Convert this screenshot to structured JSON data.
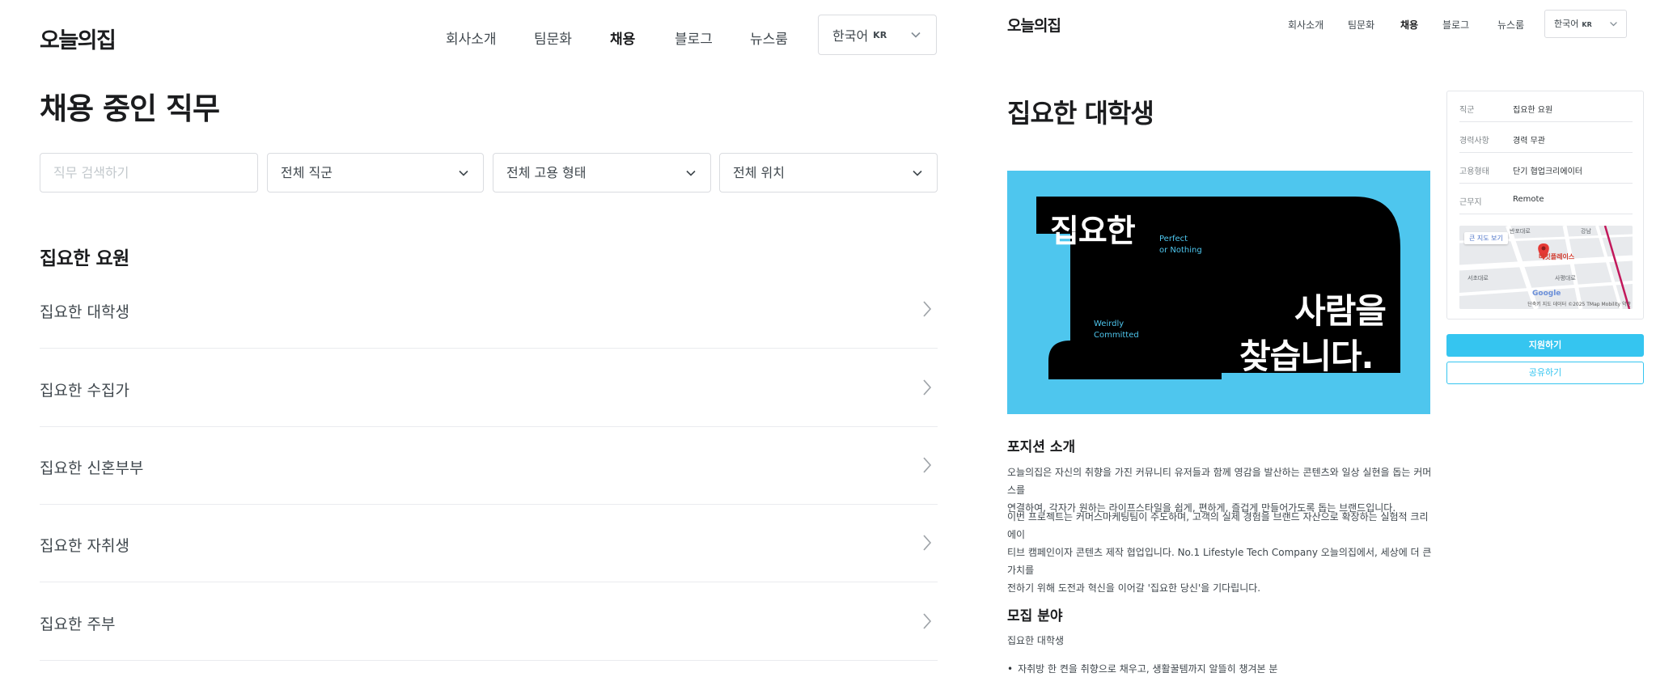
{
  "left": {
    "logo": "오늘의집",
    "nav": [
      "회사소개",
      "팀문화",
      "채용",
      "블로그",
      "뉴스룸"
    ],
    "nav_active": "채용",
    "lang": {
      "label": "한국어",
      "code": "KR"
    },
    "title": "채용 중인 직무",
    "search_placeholder": "직무 검색하기",
    "filters": [
      "전체 직군",
      "전체 고용 형태",
      "전체 위치"
    ],
    "section_title": "집요한 요원",
    "jobs": [
      "집요한 대학생",
      "집요한 수집가",
      "집요한 신혼부부",
      "집요한 자취생",
      "집요한 주부"
    ]
  },
  "right": {
    "logo": "오늘의집",
    "nav": [
      "회사소개",
      "팀문화",
      "채용",
      "블로그",
      "뉴스룸"
    ],
    "lang": {
      "label": "한국어",
      "code": "KR"
    },
    "title": "집요한 대학생",
    "banner": {
      "big1": "집요한",
      "big2": "사람을",
      "big3": "찾습니다.",
      "small1": "Perfect",
      "small2": "or Nothing",
      "small3": "Weirdly",
      "small4": "Committed"
    },
    "section1_title": "포지션 소개",
    "para1_line1": "오늘의집은 자신의 취향을 가진 커뮤니티 유저들과 함께 영감을 발산하는 콘텐츠와 일상 실현을 돕는 커머스를",
    "para1_line2": "연결하여, 각자가 원하는 라이프스타일을 쉽게, 편하게, 즐겁게 만들어가도록 돕는 브랜드입니다.",
    "para2_line1": "이번 프로젝트는 커머스마케팅팀이 주도하며, 고객의 실제 경험을 브랜드 자산으로 확장하는 실험적 크리에이",
    "para2_line2": "티브 캠페인이자 콘텐츠 제작 협업입니다. No.1 Lifestyle Tech Company 오늘의집에서, 세상에 더 큰 가치를",
    "para2_line3": "전하기 위해 도전과 혁신을 이어갈 '집요한 당신'을 기다립니다.",
    "section2_title": "모집 분야",
    "field_name": "집요한 대학생",
    "bullet1": "자취방 한 켠을 취향으로 채우고, 생활꿀템까지 알뜰히 챙겨본 분",
    "info": [
      {
        "key": "직군",
        "value": "집요한 요원"
      },
      {
        "key": "경력사항",
        "value": "경력 무관"
      },
      {
        "key": "고용형태",
        "value": "단기 협업크리에이터"
      },
      {
        "key": "근무지",
        "value": "Remote"
      }
    ],
    "map": {
      "button": "큰 지도 보기",
      "place": "버킷플레이스",
      "google": "Google",
      "credit": "단축키 지도 데이터 ©2025 TMap Mobility 약관",
      "labels": [
        "강남",
        "서초대로",
        "사평대로",
        "반포대로"
      ]
    },
    "apply_label": "지원하기",
    "share_label": "공유하기"
  },
  "colors": {
    "accent": "#35c5f0",
    "banner_bg": "#4ec6ee",
    "text": "#2f3438"
  }
}
